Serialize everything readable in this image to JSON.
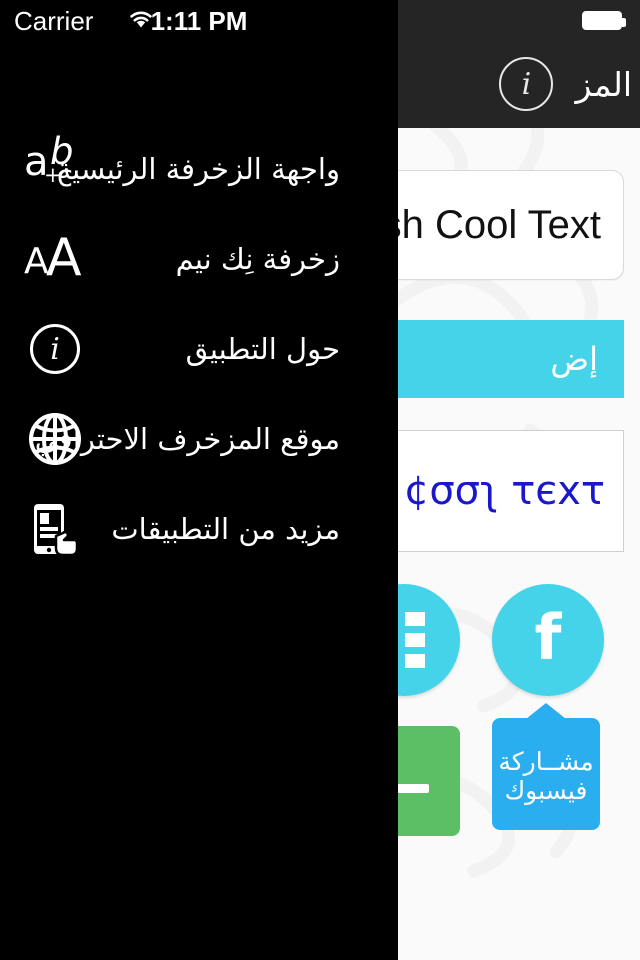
{
  "status_bar": {
    "carrier": "Carrier",
    "wifi_icon": "wifi-icon",
    "time": "1:11 PM",
    "battery_icon": "battery-full-icon"
  },
  "navbar": {
    "title": "المز",
    "info_button_glyph": "i",
    "info_icon": "info-circle-icon",
    "background_color": "#252525"
  },
  "drawer": {
    "background_color": "#000000",
    "items": [
      {
        "label": "واجهة الزخرفة الرئيسية",
        "icon": "abc-plus-icon"
      },
      {
        "label": "زخرفة نِك نيم",
        "icon": "aa-typography-icon"
      },
      {
        "label": "حول التطبيق",
        "icon": "info-circle-icon"
      },
      {
        "label": "موقع المزخرف الاحترافي",
        "icon": "globe-icon"
      },
      {
        "label": "مزيد من التطبيقات",
        "icon": "more-apps-phone-tap-icon"
      }
    ]
  },
  "main": {
    "text_input": {
      "value": "ish Cool Text",
      "placeholder": "English Cool Text"
    },
    "decorate_button": {
      "label": "إض",
      "color": "#44D3E8"
    },
    "result": {
      "text": "¢σσʅ τєxτ",
      "action_icon": "play-triangle-icon",
      "action_color": "#62AACB"
    },
    "circle_buttons": [
      {
        "icon": "grid-list-icon",
        "color": "#44D3E8"
      },
      {
        "icon": "facebook-f-icon",
        "color": "#44D3E8",
        "glyph": "f"
      }
    ],
    "green_button": {
      "icon": "dash-icon",
      "color": "#5CBF66"
    },
    "facebook_tooltip": {
      "line1": "مشــاركة",
      "line2": "فيسبوك",
      "color": "#2BAEF0"
    }
  }
}
